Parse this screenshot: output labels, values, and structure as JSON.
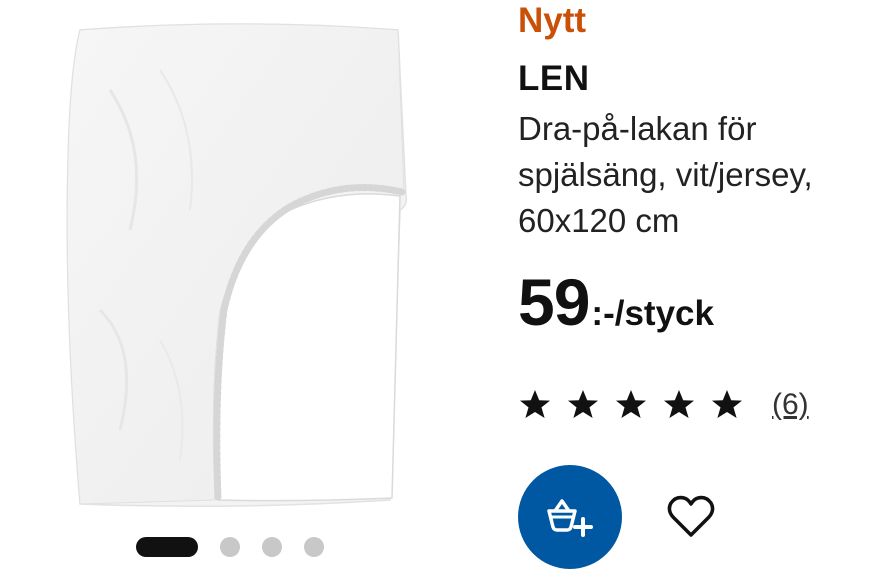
{
  "product": {
    "badge": "Nytt",
    "name": "LEN",
    "description": "Dra-på-lakan för spjälsäng, vit/jersey, 60x120 cm",
    "price_integer": "59",
    "price_suffix": ":-/styck",
    "rating": {
      "stars": 5,
      "count_label": "(6)"
    },
    "image": {
      "icon": "fitted-sheet-image",
      "color": "#ffffff"
    }
  },
  "carousel": {
    "total": 4,
    "active_index": 0
  },
  "actions": {
    "add_to_cart_icon": "cart-add-icon",
    "favourite_icon": "heart-outline-icon"
  },
  "colors": {
    "badge": "#ca5008",
    "cart_button": "#0058a3",
    "active_dot": "#111111",
    "inactive_dot": "#c8c8c8"
  }
}
